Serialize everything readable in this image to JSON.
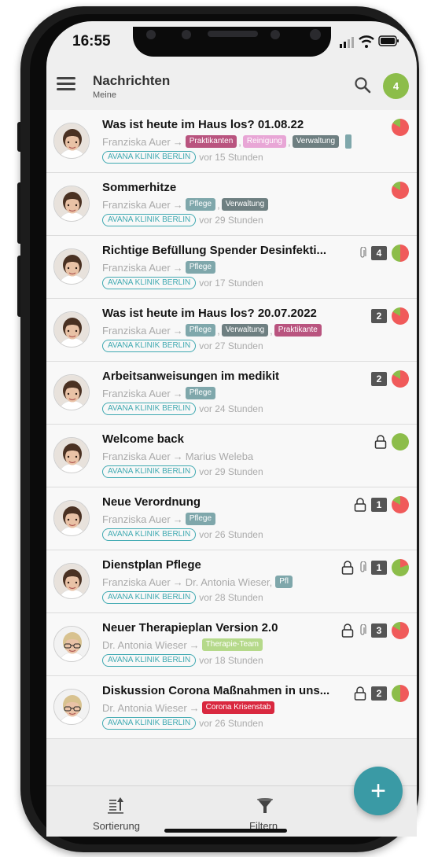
{
  "status": {
    "time": "16:55"
  },
  "header": {
    "title": "Nachrichten",
    "subtitle": "Meine",
    "badge_count": "4"
  },
  "colors": {
    "accent": "#3a9aa5",
    "green": "#8cbd4a",
    "red": "#f05a5a"
  },
  "messages": [
    {
      "subject": "Was ist heute im Haus los? 01.08.22",
      "sender": "Franziska Auer",
      "tags": [
        {
          "label": "Praktikanten",
          "color": "#b9547f"
        },
        {
          "label": "Reinigung",
          "color": "#e8a6d6"
        },
        {
          "label": "Verwaltung",
          "color": "#6e7f81"
        }
      ],
      "org": "AVANA KLINIK BERLIN",
      "ago": "vor 15 Stunden",
      "count": "",
      "lock": false,
      "clip": false,
      "status_color": "red",
      "avatar": "woman"
    },
    {
      "subject": "Sommerhitze",
      "sender": "Franziska Auer",
      "tags": [
        {
          "label": "Pflege",
          "color": "#7fa7ab"
        },
        {
          "label": "Verwaltung",
          "color": "#6e7f81"
        }
      ],
      "org": "AVANA KLINIK BERLIN",
      "ago": "vor 29 Stunden",
      "count": "",
      "lock": false,
      "clip": false,
      "status_color": "red",
      "avatar": "woman"
    },
    {
      "subject": "Richtige Befüllung Spender Desinfekti...",
      "sender": "Franziska Auer",
      "tags": [
        {
          "label": "Pflege",
          "color": "#7fa7ab"
        }
      ],
      "org": "AVANA KLINIK BERLIN",
      "ago": "vor 17 Stunden",
      "count": "4",
      "lock": false,
      "clip": true,
      "status_color": "half",
      "avatar": "woman"
    },
    {
      "subject": "Was ist heute im Haus los? 20.07.2022",
      "sender": "Franziska Auer",
      "tags": [
        {
          "label": "Pflege",
          "color": "#7fa7ab"
        },
        {
          "label": "Verwaltung",
          "color": "#6e7f81"
        },
        {
          "label": "Praktikante",
          "color": "#b9547f"
        }
      ],
      "org": "AVANA KLINIK BERLIN",
      "ago": "vor 27 Stunden",
      "count": "2",
      "lock": false,
      "clip": false,
      "status_color": "red",
      "avatar": "woman"
    },
    {
      "subject": "Arbeitsanweisungen im medikit",
      "sender": "Franziska Auer",
      "tags": [
        {
          "label": "Pflege",
          "color": "#7fa7ab"
        }
      ],
      "org": "AVANA KLINIK BERLIN",
      "ago": "vor 24 Stunden",
      "count": "2",
      "lock": false,
      "clip": false,
      "status_color": "red",
      "avatar": "woman"
    },
    {
      "subject": "Welcome back",
      "sender": "Franziska Auer",
      "recipient": "Marius Weleba",
      "tags": [],
      "org": "AVANA KLINIK BERLIN",
      "ago": "vor 29 Stunden",
      "count": "",
      "lock": true,
      "clip": false,
      "status_color": "green",
      "avatar": "woman"
    },
    {
      "subject": "Neue Verordnung",
      "sender": "Franziska Auer",
      "tags": [
        {
          "label": "Pflege",
          "color": "#7fa7ab"
        }
      ],
      "org": "AVANA KLINIK BERLIN",
      "ago": "vor 26 Stunden",
      "count": "1",
      "lock": true,
      "clip": false,
      "status_color": "red",
      "avatar": "woman"
    },
    {
      "subject": "Dienstplan Pflege",
      "sender": "Franziska Auer",
      "recipient": "Dr. Antonia Wieser,",
      "tags": [
        {
          "label": "Pfl",
          "color": "#7fa7ab"
        }
      ],
      "org": "AVANA KLINIK BERLIN",
      "ago": "vor 28 Stunden",
      "count": "1",
      "lock": true,
      "clip": true,
      "status_color": "mostly-green",
      "avatar": "woman"
    },
    {
      "subject": "Neuer Therapieplan Version 2.0",
      "sender": "Dr. Antonia Wieser",
      "tags": [
        {
          "label": "Therapie-Team",
          "color": "#b5d98a"
        }
      ],
      "org": "AVANA KLINIK BERLIN",
      "ago": "vor 18 Stunden",
      "count": "3",
      "lock": true,
      "clip": true,
      "status_color": "red",
      "avatar": "blonde"
    },
    {
      "subject": "Diskussion Corona Maßnahmen in uns...",
      "sender": "Dr. Antonia Wieser",
      "tags": [
        {
          "label": "Corona Krisenstab",
          "color": "#d9283f"
        }
      ],
      "org": "AVANA KLINIK BERLIN",
      "ago": "vor 26 Stunden",
      "count": "2",
      "lock": true,
      "clip": false,
      "status_color": "half",
      "avatar": "blonde"
    }
  ],
  "bottom": {
    "sort_label": "Sortierung",
    "filter_label": "Filtern",
    "fab_label": "+"
  }
}
